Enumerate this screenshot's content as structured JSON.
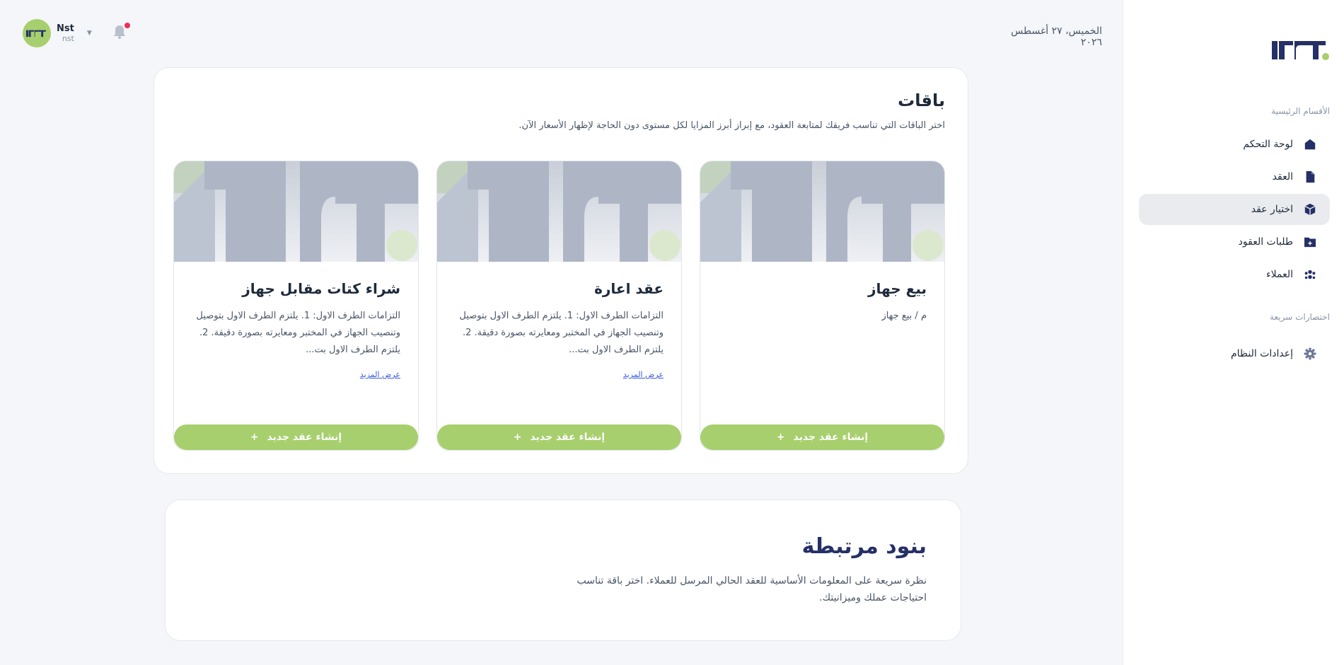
{
  "header": {
    "date": "الخميس، ٢٧ أغسطس ٢٠٢٦",
    "user_name": "Nst",
    "user_sub": "nst",
    "logo_text": "NST"
  },
  "sidebar": {
    "main_section_title": "الأقسام الرئيسية",
    "items": [
      {
        "label": "لوحة التحكم",
        "icon": "home-icon"
      },
      {
        "label": "العقد",
        "icon": "document-icon"
      },
      {
        "label": "اختيار عقد",
        "icon": "cube-icon",
        "active": true
      },
      {
        "label": "طلبات العقود",
        "icon": "folder-plus-icon"
      },
      {
        "label": "العملاء",
        "icon": "users-icon"
      }
    ],
    "shortcuts_title": "اختصارات سريعة",
    "shortcuts": [
      {
        "label": "إعدادات النظام",
        "icon": "gear-icon"
      }
    ]
  },
  "packages": {
    "title": "باقات",
    "subtitle": "اختر الباقات التي تناسب فريقك لمتابعة العقود، مع إبراز أبرز المزايا لكل مستوى دون الحاجة لإظهار الأسعار الآن.",
    "items": [
      {
        "title": "بيع جهاز",
        "description": "م / بيع جهاز",
        "more": "",
        "button": "إنشاء عقد جديد"
      },
      {
        "title": "عقد اعارة",
        "description": "التزامات الطرف الاول: 1. يلتزم الطرف الاول بتوصيل وتنصيب الجهاز في المختبر ومعايرته بصورة دقيقة. 2. يلتزم الطرف الاول بت...",
        "more": "عرض المزيد",
        "button": "إنشاء عقد جديد"
      },
      {
        "title": "شراء كتات مقابل جهاز",
        "description": "التزامات الطرف الاول: 1. يلتزم الطرف الاول بتوصيل وتنصيب الجهاز في المختبر ومعايرته بصورة دقيقة. 2. يلتزم الطرف الاول بت...",
        "more": "عرض المزيد",
        "button": "إنشاء عقد جديد"
      }
    ]
  },
  "related": {
    "title": "بنود مرتبطة",
    "description": "نظرة سريعة على المعلومات الأساسية للعقد الحالي المرسل للعملاء. اختر باقة تناسب احتياجات عملك وميزانيتك."
  },
  "colors": {
    "accent_green": "#a7cf6d",
    "active_bg": "#e9ebef",
    "navy": "#253066",
    "link": "#3b5bdb",
    "notification": "#ef2d56"
  }
}
